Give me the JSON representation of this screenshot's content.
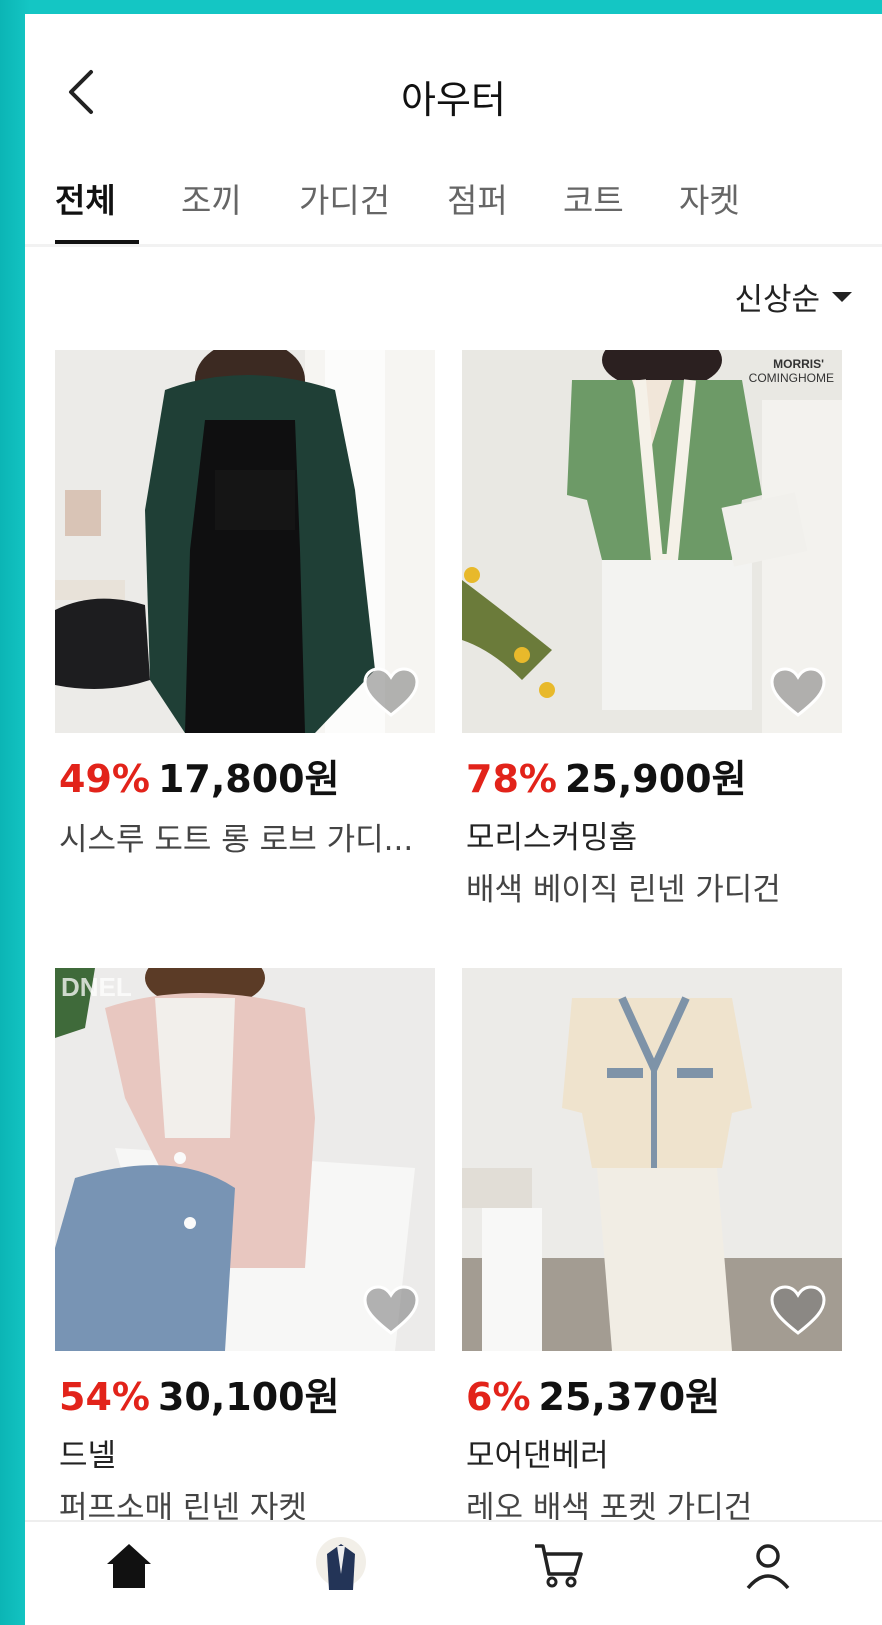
{
  "header": {
    "title": "아우터"
  },
  "tabs": [
    {
      "label": "전체",
      "active": true
    },
    {
      "label": "조끼",
      "active": false
    },
    {
      "label": "가디건",
      "active": false
    },
    {
      "label": "점퍼",
      "active": false
    },
    {
      "label": "코트",
      "active": false
    },
    {
      "label": "자켓",
      "active": false
    }
  ],
  "sort": {
    "label": "신상순"
  },
  "products": [
    {
      "discount": "49%",
      "price": "17,800원",
      "brand": "",
      "name": "시스루 도트 롱 로브 가디..."
    },
    {
      "discount": "78%",
      "price": "25,900원",
      "brand": "모리스커밍홈",
      "name": "배색 베이직 린넨 가디건",
      "watermark": "MORRIS' COMINGHOME"
    },
    {
      "discount": "54%",
      "price": "30,100원",
      "brand": "드넬",
      "name": "퍼프소매 린넨 자켓",
      "watermark": "DNEL"
    },
    {
      "discount": "6%",
      "price": "25,370원",
      "brand": "모어댄베러",
      "name": "레오 배색 포켓 가디건"
    }
  ],
  "bottom_nav": [
    "home-icon",
    "outfit-icon",
    "cart-icon",
    "profile-icon"
  ],
  "colors": {
    "accent_discount": "#e2231a",
    "frame": "#14c6c4"
  }
}
